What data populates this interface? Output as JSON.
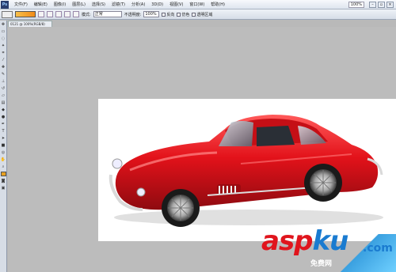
{
  "menubar": {
    "items": [
      "文件(F)",
      "编辑(E)",
      "图像(I)",
      "图层(L)",
      "选择(S)",
      "滤镜(T)",
      "分析(A)",
      "3D(D)",
      "视图(V)",
      "窗口(W)",
      "帮助(H)"
    ],
    "zoom": "100%"
  },
  "options": {
    "mode_label": "模式:",
    "mode_value": "正常",
    "opacity_label": "不透明度:",
    "opacity_value": "100%",
    "reverse_label": "反向",
    "dither_label": "仿色",
    "transparency_label": "透明区域"
  },
  "document": {
    "tab": "0121 @ 100%(RGB/8)"
  },
  "watermark": {
    "asp": "asp",
    "ku": "ku",
    "dot": ".com",
    "sub": "免费网"
  },
  "colors": {
    "car_body": "#e3121a",
    "watermark_red": "#e0151d",
    "watermark_blue": "#1a7bd0"
  }
}
